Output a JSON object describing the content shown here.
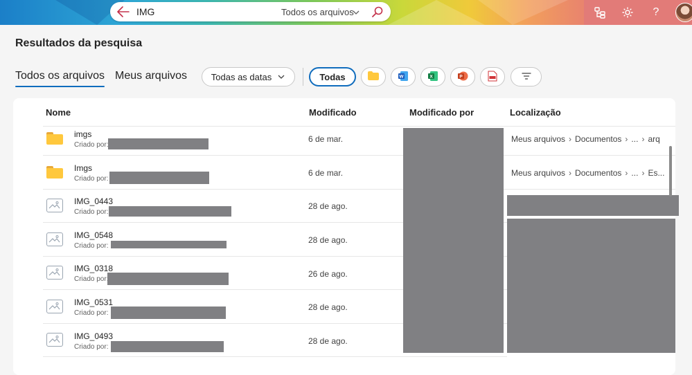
{
  "search": {
    "query": "IMG",
    "scope_label": "Todos os arquivos"
  },
  "page": {
    "title": "Resultados da pesquisa"
  },
  "tabs": [
    {
      "label": "Todos os arquivos",
      "selected": true
    },
    {
      "label": "Meus arquivos",
      "selected": false
    }
  ],
  "filters": {
    "date_label": "Todas as datas",
    "type_all_label": "Todas",
    "type_icons": [
      "folder-icon",
      "word-icon",
      "excel-icon",
      "powerpoint-icon",
      "pdf-icon"
    ],
    "more_filters_icon": "filter-lines-icon"
  },
  "columns": {
    "name": "Nome",
    "modified": "Modificado",
    "modified_by": "Modificado por",
    "location": "Localização"
  },
  "created_by_label": "Criado por:",
  "rows": [
    {
      "name": "imgs",
      "type": "folder",
      "modified": "6 de mar.",
      "location": [
        "Meus arquivos",
        "Documentos",
        "...",
        "arq"
      ]
    },
    {
      "name": "Imgs",
      "type": "folder",
      "modified": "6 de mar.",
      "location": [
        "Meus arquivos",
        "Documentos",
        "...",
        "Es..."
      ]
    },
    {
      "name": "IMG_0443",
      "type": "image",
      "modified": "28 de ago.",
      "location": []
    },
    {
      "name": "IMG_0548",
      "type": "image",
      "modified": "28 de ago.",
      "location": []
    },
    {
      "name": "IMG_0318",
      "type": "image",
      "modified": "26 de ago.",
      "location": []
    },
    {
      "name": "IMG_0531",
      "type": "image",
      "modified": "28 de ago.",
      "location": []
    },
    {
      "name": "IMG_0493",
      "type": "image",
      "modified": "28 de ago.",
      "location": []
    }
  ],
  "colors": {
    "accent": "#0f6cbd",
    "redaction": "#808083",
    "folder": "#ffc83d"
  }
}
